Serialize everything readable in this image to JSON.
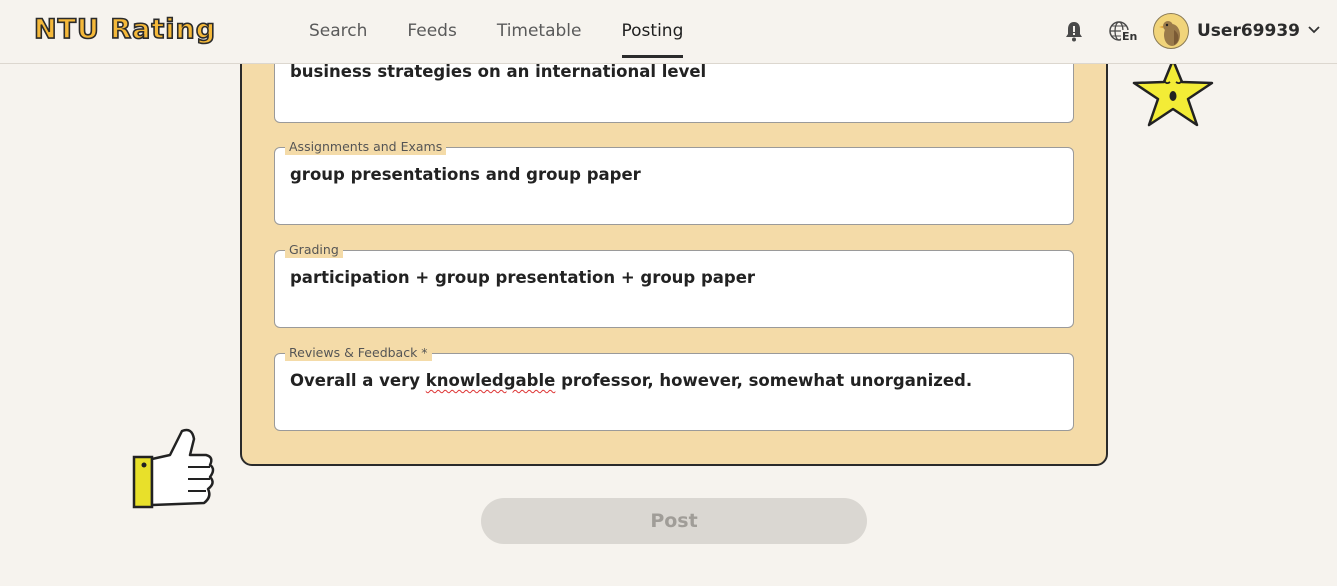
{
  "app": {
    "logo_text": "NTU Rating"
  },
  "nav": {
    "items": [
      {
        "label": "Search",
        "active": false
      },
      {
        "label": "Feeds",
        "active": false
      },
      {
        "label": "Timetable",
        "active": false
      },
      {
        "label": "Posting",
        "active": true
      }
    ]
  },
  "header": {
    "language_code": "En",
    "username": "User69939"
  },
  "form": {
    "fields": [
      {
        "legend": "",
        "value": "business strategies on an international level"
      },
      {
        "legend": "Assignments and Exams",
        "value": "group presentations and group paper"
      },
      {
        "legend": "Grading",
        "value": "participation + group presentation + group paper"
      },
      {
        "legend": "Reviews & Feedback *",
        "value_parts": [
          "Overall a very ",
          "knowledgable",
          " professor, however, somewhat unorganized."
        ]
      }
    ],
    "post_label": "Post"
  },
  "colors": {
    "page_bg": "#f6f3ee",
    "panel_bg": "#f4dba8",
    "logo_fill": "#f5b93a",
    "post_button_disabled": "#dad7d2"
  },
  "icons": [
    "bell-icon",
    "globe-language-icon",
    "bird-avatar-icon",
    "chevron-down-icon",
    "star-mascot-icon",
    "thumbs-up-icon"
  ]
}
